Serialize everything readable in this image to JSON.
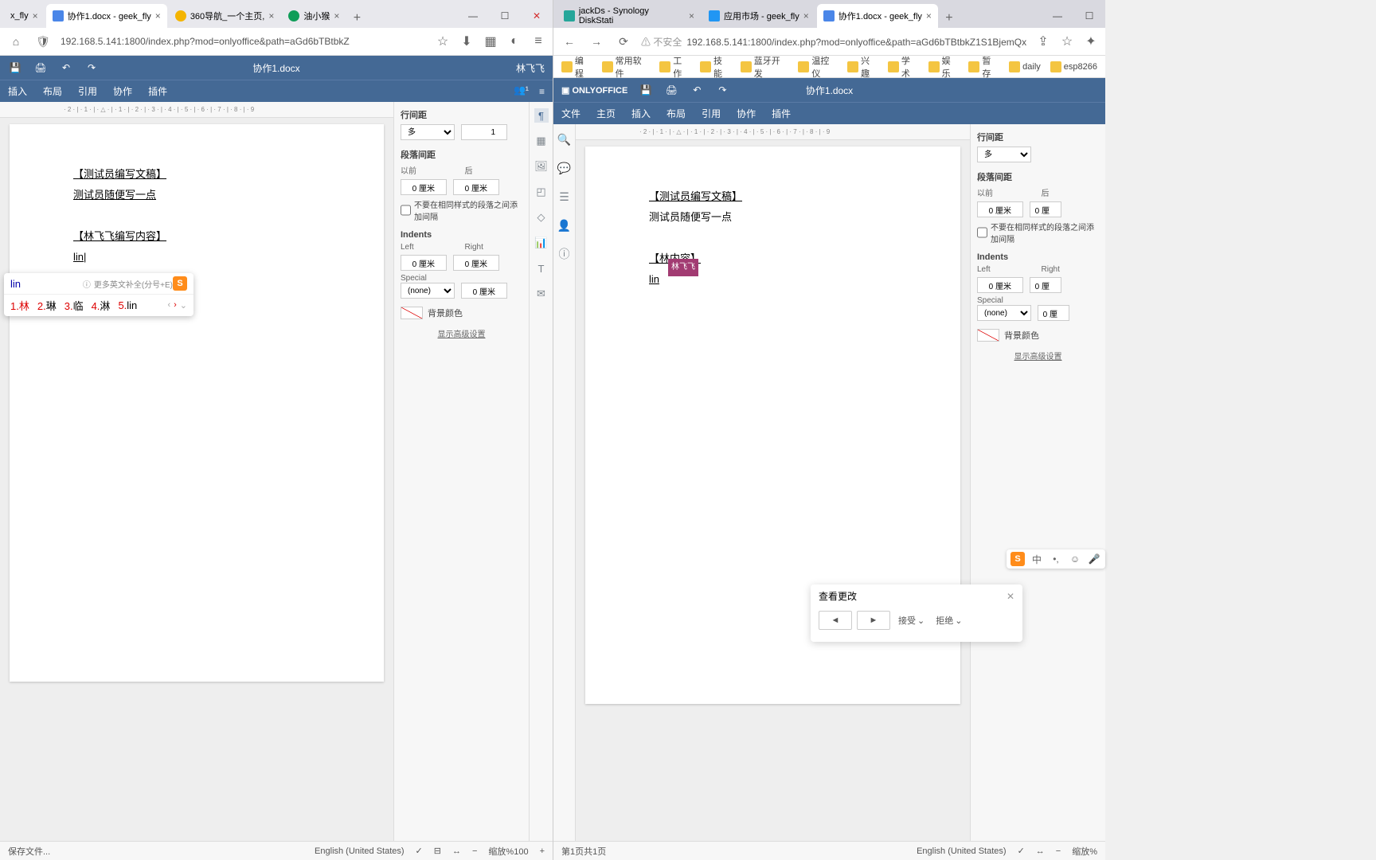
{
  "left": {
    "tabs": [
      {
        "label": "x_fly",
        "active": false
      },
      {
        "label": "协作1.docx - geek_fly",
        "active": true
      },
      {
        "label": "360导航_一个主页,",
        "active": false
      },
      {
        "label": "油小猴",
        "active": false
      }
    ],
    "url": "192.168.5.141:1800/index.php?mod=onlyoffice&path=aGd6bTBtbkZ",
    "doc_title": "协作1.docx",
    "user": "林飞飞",
    "menus": [
      "插入",
      "布局",
      "引用",
      "协作",
      "插件"
    ],
    "doc": {
      "l1": "【测试员编写文稿】",
      "l2": "测试员随便写一点",
      "l3": "【林飞飞编写内容】",
      "l4": "lin"
    },
    "status": {
      "save": "保存文件...",
      "lang": "English (United States)",
      "zoom": "缩放%100"
    }
  },
  "right": {
    "tabs": [
      {
        "label": "jackDs - Synology DiskStati"
      },
      {
        "label": "应用市场 - geek_fly"
      },
      {
        "label": "协作1.docx - geek_fly",
        "active": true
      }
    ],
    "unsafe": "不安全",
    "url": "192.168.5.141:1800/index.php?mod=onlyoffice&path=aGd6bTBtbkZ1S1BjemQx...",
    "bookmarks": [
      "编程",
      "常用软件",
      "工作",
      "技能",
      "蓝牙开发",
      "温控仪",
      "兴趣",
      "学术",
      "娱乐",
      "暂存",
      "daily",
      "esp8266"
    ],
    "oo_brand": "ONLYOFFICE",
    "doc_title": "协作1.docx",
    "menus": [
      "文件",
      "主页",
      "插入",
      "布局",
      "引用",
      "协作",
      "插件"
    ],
    "doc": {
      "l1": "【测试员编写文稿】",
      "l2": "测试员随便写一点",
      "l3_pre": "【林",
      "l3_label": "林飞飞",
      "l3_post": "内容】",
      "l4": "lin"
    },
    "status": {
      "page": "第1页共1页",
      "lang": "English (United States)",
      "zoom": "缩放%"
    }
  },
  "panel": {
    "line_spacing": "行间距",
    "ls_mode": "多",
    "ls_val": "1",
    "para_spacing": "段落间距",
    "before": "以前",
    "after": "后",
    "val0": "0 厘米",
    "nosame": "不要在相同样式的段落之间添加间隔",
    "indents": "Indents",
    "left": "Left",
    "right": "Right",
    "special": "Special",
    "none": "(none)",
    "bg": "背景颜色",
    "adv": "显示高级设置"
  },
  "ime": {
    "input": "lin",
    "hint": "更多英文补全(分号+E)",
    "cands": [
      {
        "n": "1.",
        "c": "林"
      },
      {
        "n": "2.",
        "c": "琳"
      },
      {
        "n": "3.",
        "c": "临"
      },
      {
        "n": "4.",
        "c": "淋"
      },
      {
        "n": "5.",
        "c": "lin"
      }
    ]
  },
  "review": {
    "title": "查看更改",
    "accept": "接受",
    "reject": "拒绝"
  },
  "ruler": "· 2 · | · 1 · | · △ · | · 1 · | · 2 · | · 3 · | · 4 · | · 5 · | · 6 · | · 7 · | · 8 · | · 9"
}
